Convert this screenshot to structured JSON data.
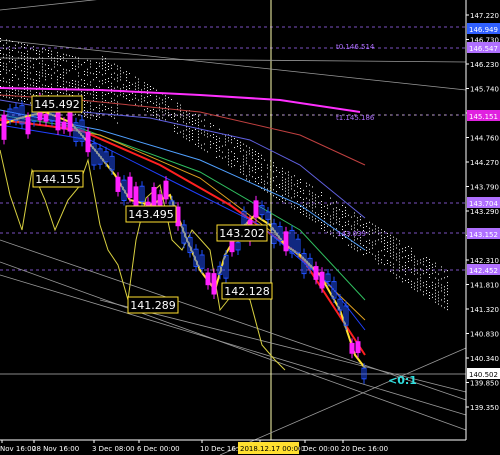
{
  "chart_data": {
    "type": "line",
    "price_axis": [
      "147.220",
      "146.730",
      "146.230",
      "145.740",
      "145.250",
      "144.760",
      "144.270",
      "143.790",
      "143.290",
      "142.800",
      "142.310",
      "141.810",
      "141.320",
      "140.830",
      "140.340",
      "139.850",
      "139.350"
    ],
    "time_axis": [
      "Nov 16:00",
      "28 Nov 16:00",
      "3 Dec 08:00",
      "6 Dec 00:00",
      "10 Dec 16:00",
      "13 Dec 08:00",
      "Dec 00:00",
      "20 Dec 16:00"
    ],
    "crosshair_time": "2018.12.17 00:00",
    "price_tags": [
      {
        "text": "146.949",
        "color": "#3060ff"
      },
      {
        "text": "146.547",
        "color": "#b070ff"
      },
      {
        "text": "145.151",
        "color": "#e020e0"
      },
      {
        "text": "143.704",
        "color": "#b070ff"
      },
      {
        "text": "143.152",
        "color": "#b070ff"
      },
      {
        "text": "142.452",
        "color": "#b070ff"
      },
      {
        "text": "140.502",
        "color": "#ffffff"
      }
    ],
    "level_labels": [
      {
        "text": "t0.146.514",
        "color": "#b070ff"
      },
      {
        "text": "t1.145.186",
        "color": "#b070ff"
      },
      {
        "text": "143.039",
        "color": "#b070ff"
      }
    ],
    "point_labels": [
      "145.492",
      "144.155",
      "143.495",
      "143.202",
      "142.128",
      "141.289"
    ],
    "countdown": "<0:1",
    "colors": {
      "background": "#000000",
      "axis": "#ffffff",
      "yellow": "#ffe030",
      "red": "#ff2020",
      "bull": "#2050ff",
      "bear": "#ff20ff",
      "cloud": "#ffffff",
      "magenta": "#ff20ff",
      "cyan": "#30e0e0"
    }
  }
}
